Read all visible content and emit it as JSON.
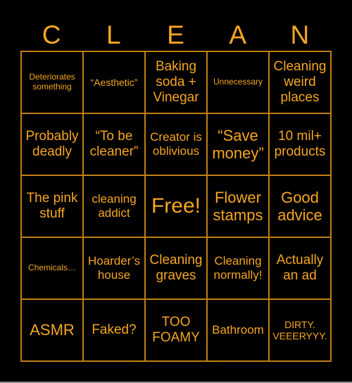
{
  "header": {
    "letters": [
      "C",
      "L",
      "E",
      "A",
      "N"
    ]
  },
  "colors": {
    "background": "#000000",
    "text": "#f5a623",
    "grid": "#c07f12"
  },
  "board": {
    "rows": [
      [
        "Deteriorates something",
        "“Aesthetic”",
        "Baking soda + Vinegar",
        "Unnecessary",
        "Cleaning weird places"
      ],
      [
        "Probably deadly",
        "“To be cleaner”",
        "Creator is oblivious",
        "“Save money”",
        "10 mil+ products"
      ],
      [
        "The pink stuff",
        "cleaning addict",
        "Free!",
        "Flower stamps",
        "Good advice"
      ],
      [
        "Chemicals…",
        "Hoarder’s house",
        "Cleaning graves",
        "Cleaning normally!",
        "Actually an ad"
      ],
      [
        "ASMR",
        "Faked?",
        "TOO FOAMY",
        "Bathroom",
        "DIRTY. VEEERYYY."
      ]
    ],
    "free_space": "Free!"
  }
}
